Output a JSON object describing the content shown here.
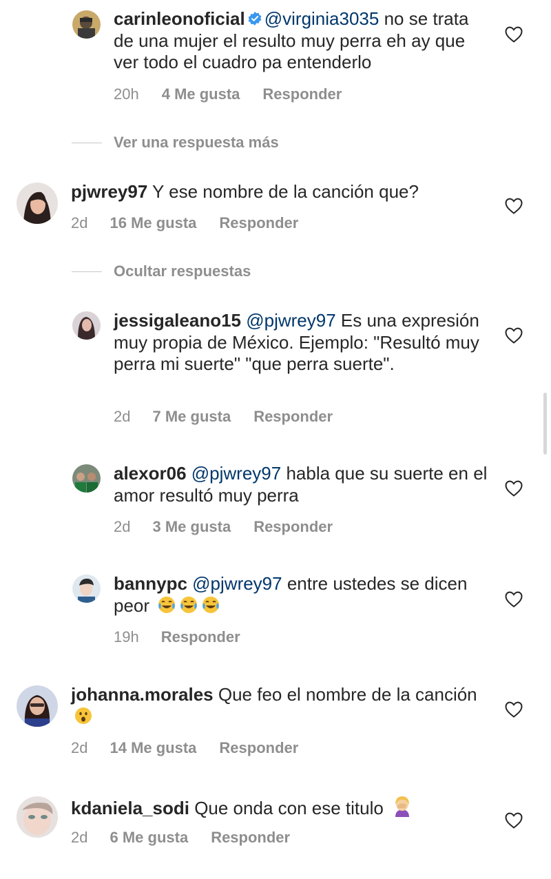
{
  "comments": [
    {
      "username": "carinleonoficial",
      "verified": true,
      "mention": "@virginia3035",
      "text": " no se trata de una mujer el resulto muy perra eh ay que ver todo el cuadro pa entenderlo",
      "time": "20h",
      "likes": "4 Me gusta",
      "reply": "Responder"
    },
    {
      "username": "pjwrey97",
      "text": " Y ese nombre de la canción que?",
      "time": "2d",
      "likes": "16 Me gusta",
      "reply": "Responder"
    },
    {
      "username": "jessigaleano15",
      "mention": "@pjwrey97",
      "text": " Es una expresión muy propia de México. Ejemplo: \"Resultó muy perra mi suerte\" \"que perra suerte\".",
      "time": "2d",
      "likes": "7 Me gusta",
      "reply": "Responder"
    },
    {
      "username": "alexor06",
      "mention": "@pjwrey97",
      "text": " habla que su suerte en el amor resultó muy perra",
      "time": "2d",
      "likes": "3 Me gusta",
      "reply": "Responder"
    },
    {
      "username": "bannypc",
      "mention": "@pjwrey97",
      "text": " entre ustedes se dicen peor ",
      "emoji": "tears-of-joy-emoji",
      "time": "19h",
      "reply": "Responder"
    },
    {
      "username": "johanna.morales",
      "text": " Que feo el nombre de la canción ",
      "emoji": "surprised-face-emoji",
      "time": "2d",
      "likes": "14 Me gusta",
      "reply": "Responder"
    },
    {
      "username": "kdaniela_sodi",
      "text": " Que onda con ese titulo ",
      "emoji": "facepalm-emoji",
      "time": "2d",
      "likes": "6 Me gusta",
      "reply": "Responder"
    }
  ],
  "toggles": {
    "more_replies": "Ver una respuesta más",
    "hide_replies": "Ocultar respuestas"
  },
  "colors": {
    "mention": "#00376b",
    "meta_gray": "#8e8e8e",
    "verified_blue": "#3897f0"
  }
}
